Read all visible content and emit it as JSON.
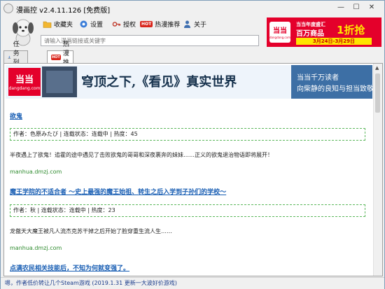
{
  "window": {
    "title": "漫画控 v2.4.11.126 [免费版]",
    "min_glyph": "—",
    "max_glyph": "☐",
    "close_glyph": "✕"
  },
  "toolbar": {
    "favorites_label": "收藏夹",
    "settings_label": "设置",
    "authorize_label": "授权",
    "hot_badge": "HOT",
    "hot_label": "热漫推荐",
    "about_label": "关于"
  },
  "search": {
    "placeholder": "请输入漫画链接或关键字"
  },
  "ad_top": {
    "logo_text": "当当",
    "logo_sub": "dangdang.com",
    "line1": "当当年度盛汇",
    "line2": "百万商品",
    "line3": "1折抢",
    "dates": "3月24日-3月29日"
  },
  "tabs": [
    {
      "label": "任务列表",
      "icon": "download-icon"
    },
    {
      "label": "热漫推荐",
      "icon": "hot-icon"
    }
  ],
  "banner": {
    "logo_text": "当当",
    "logo_sub": "dangdang.com",
    "headline": "穹顶之下,《看见》真实世界",
    "side_line1": "当当千万读者",
    "side_line2": "向柴静的良知与担当致敬!"
  },
  "entries": [
    {
      "title": "欲鬼",
      "meta": "作者：色原みたび | 连载状态：连载中 | 热度：45",
      "desc": "半夜遇上了欲鬼！追霍的途中遇见了击败欲鬼的哥哥和深夜裹奔的妹妹……正义的欲鬼退治物语即将展开！",
      "source": "manhua.dmzj.com"
    },
    {
      "title": "魔王学院的不适合者 ～史上最强的魔王始祖、转生之后入学到子孙们的学校～",
      "meta": "作者：秋 | 连载状态：连载中 | 热度：23",
      "desc": "龙傲天大魔王被凡人流杰克苏干掉之后开始了脸穿重生流人生……",
      "source": "manhua.dmzj.com"
    },
    {
      "title": "点满农民相关技能后，不知为何就变强了。"
    }
  ],
  "statusbar": {
    "text": "嗯，作者低价转让几个Steam游戏 (2019.1.31 更新一大波好价游戏)"
  }
}
